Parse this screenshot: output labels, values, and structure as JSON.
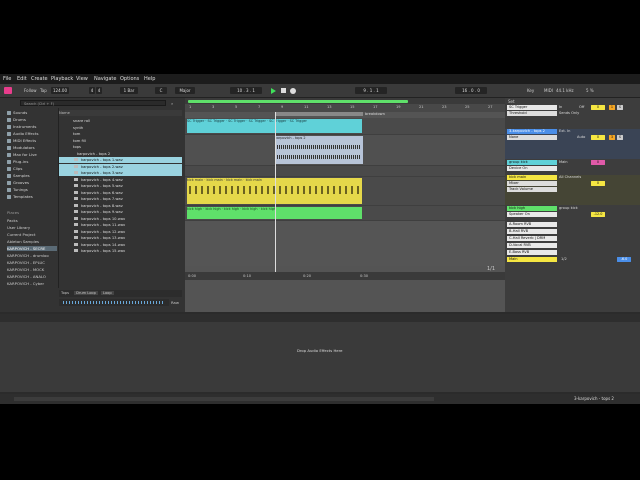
{
  "menu": [
    "File",
    "Edit",
    "Create",
    "Playback",
    "View",
    "Navigate",
    "Options",
    "Help"
  ],
  "transport": {
    "follow": "Follow",
    "tap": "Tap",
    "tempo": "124.00",
    "sig_num": "4",
    "sig_den": "4",
    "quant": "1 Bar",
    "key": "C",
    "scale": "Major",
    "position": "10 . 3 . 1",
    "loop_start": "9 . 1 . 1",
    "loop_len": "16 . 0 . 0",
    "key_label": "Key",
    "midi_label": "MIDI",
    "cpu": "44.1 kHz",
    "cpu_pct": "5 %"
  },
  "browser": {
    "search_placeholder": "Search (Ctrl + F)",
    "categories": [
      "Sounds",
      "Drums",
      "Instruments",
      "Audio Effects",
      "MIDI Effects",
      "Modulators",
      "Max for Live",
      "Plug-ins",
      "Clips",
      "Samples",
      "Grooves",
      "Tunings",
      "Templates"
    ],
    "places_header": "Places",
    "places": [
      "Packs",
      "User Library",
      "Current Project",
      "Ableton Samples",
      "KARPOVICH - SECRE",
      "KARPOVICH - drumloo",
      "KARPOVICH - EPLUC",
      "KARPOVICH - MOCK",
      "KARPOVICH - ANALO",
      "KARPOVICH - Cyber"
    ],
    "name_header": "Name",
    "folders": [
      "snare roll",
      "synth",
      "tom",
      "tom fill",
      "tops"
    ],
    "subfolder": "karpovich - tops 2",
    "files": [
      "karpovich - tops 1.wav",
      "karpovich - tops 2.wav",
      "karpovich - tops 3.wav",
      "karpovich - tops 4.wav",
      "karpovich - tops 5.wav",
      "karpovich - tops 6.wav",
      "karpovich - tops 7.wav",
      "karpovich - tops 8.wav",
      "karpovich - tops 9.wav",
      "karpovich - tops 10.wav",
      "karpovich - tops 11.wav",
      "karpovich - tops 12.wav",
      "karpovich - tops 13.wav",
      "karpovich - tops 14.wav",
      "karpovich - tops 15.wav"
    ],
    "preview_tags": [
      "Tops",
      "Drum Loop",
      "Loop"
    ],
    "raw": "Raw"
  },
  "arrangement": {
    "bars": [
      "1",
      "3",
      "5",
      "7",
      "9",
      "11",
      "13",
      "15",
      "17",
      "19",
      "21",
      "23",
      "25",
      "27"
    ],
    "locator": "breakdown",
    "sc_clip": "SC Trigger",
    "tops_clip": "karpovich - tops 2",
    "kick_clip": "kick main",
    "kick_high_clip": "kick high",
    "time_ticks": [
      "0:00",
      "0:10",
      "0:20",
      "0:30"
    ],
    "zoom": "1/1"
  },
  "mixer": {
    "set_label": "Set",
    "tracks": [
      {
        "name": "SC Trigger",
        "color": "#5fd1d8",
        "input": "Threshold",
        "route": "Sends Only",
        "vol": "0"
      },
      {
        "name": "3-karpovich - tops 2",
        "color": "#4a8ee8",
        "input": "None",
        "route": "Ext. In",
        "vol": "0"
      },
      {
        "name": "group kick",
        "color": "#5fd1d8",
        "input": "Device On",
        "route": "Main",
        "vol": "0"
      },
      {
        "name": "kick main",
        "color": "#f5e642",
        "input": "Mixer",
        "route": "All Channels",
        "vol": "0"
      },
      {
        "name": "kick high",
        "color": "#5fe06a",
        "input": "Speaker On",
        "route": "group kick",
        "vol": "-12.0"
      }
    ],
    "returns": [
      "A-Room RVB",
      "B-Hall RVB",
      "C-Hall Reverb | DRM",
      "D-Vocal RVB",
      "E-Bass RVB"
    ],
    "main": "Main",
    "main_vol": "1/2",
    "main_db": "-6.0",
    "track_vol_label": "Track Volume",
    "auto_label": "Auto",
    "off_label": "Off",
    "in_label": "In"
  },
  "device": {
    "drop_text": "Drop Audio Effects Here"
  },
  "status": {
    "clip_name": "3-karpovich - tops 2"
  },
  "colors": {
    "cyan": "#5fd1d8",
    "yellow": "#f5e642",
    "green": "#5fe06a",
    "blue": "#4a8ee8",
    "accent": "#f5a623"
  }
}
